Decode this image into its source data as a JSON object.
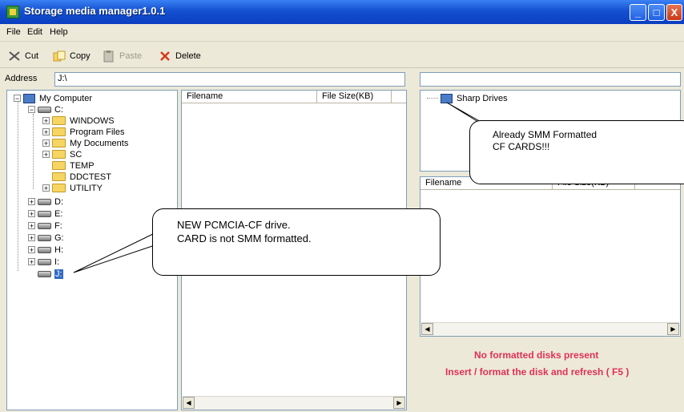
{
  "window": {
    "title": "Storage media manager1.0.1",
    "minimize": "_",
    "maximize": "□",
    "close": "X"
  },
  "menu": [
    "File",
    "Edit",
    "Help"
  ],
  "toolbar": {
    "cut": "Cut",
    "copy": "Copy",
    "paste": "Paste",
    "delete": "Delete"
  },
  "address": {
    "label": "Address",
    "value": "J:\\"
  },
  "tree": {
    "root": "My Computer",
    "c_drive": "C:",
    "folders": [
      "WINDOWS",
      "Program Files",
      "My Documents",
      "SC",
      "TEMP",
      "DDCTEST",
      "UTILITY"
    ],
    "drives": [
      "D:",
      "E:",
      "F:",
      "G:",
      "H:",
      "I:",
      "J:"
    ]
  },
  "file_list": {
    "columns": [
      "Filename",
      "File Size(KB)"
    ]
  },
  "sharp": {
    "root": "Sharp Drives"
  },
  "file_list_right": {
    "columns": [
      "Filename",
      "File Size(KB)"
    ]
  },
  "callouts": {
    "right_line1": "Already SMM Formatted",
    "right_line2": "CF CARDS!!!",
    "left_line1": "NEW PCMCIA-CF drive.",
    "left_line2": "CARD is not SMM formatted."
  },
  "status": {
    "line1": "No formatted disks present",
    "line2": "Insert / format the disk and refresh ( F5 )",
    "color": "#e0305a"
  }
}
